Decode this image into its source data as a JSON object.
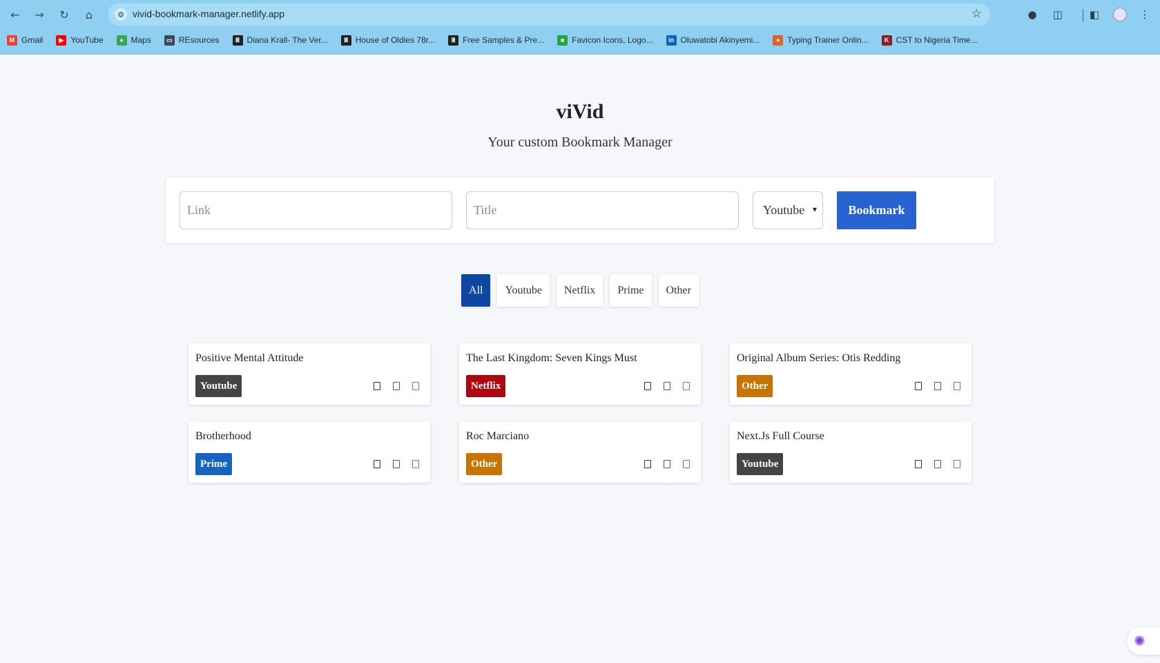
{
  "browser": {
    "url": "vivid-bookmark-manager.netlify.app",
    "icons": {
      "back": "arrow-left-icon",
      "forward": "arrow-right-icon",
      "reload": "reload-icon",
      "home": "home-icon",
      "site_info": "tune-icon",
      "star": "star-icon"
    },
    "bookmarks": [
      {
        "label": "Gmail",
        "icon": "gmail-icon",
        "color": "#ea4335",
        "glyph": "M"
      },
      {
        "label": "YouTube",
        "icon": "youtube-icon",
        "color": "#ff0000",
        "glyph": "▶"
      },
      {
        "label": "Maps",
        "icon": "maps-icon",
        "color": "#34a853",
        "glyph": "●"
      },
      {
        "label": "REsources",
        "icon": "folder-icon",
        "color": "#3c4a56",
        "glyph": "▭"
      },
      {
        "label": "Diana Krall- The Ver...",
        "icon": "site-icon",
        "color": "#222222",
        "glyph": "Ⅲ"
      },
      {
        "label": "House of Oldies 78r...",
        "icon": "site-icon",
        "color": "#222222",
        "glyph": "Ⅲ"
      },
      {
        "label": "Free Samples & Pre...",
        "icon": "piano-icon",
        "color": "#222222",
        "glyph": "Ⅲ"
      },
      {
        "label": "Favicon Icons, Logo...",
        "icon": "favicon-site-icon",
        "color": "#1fa83c",
        "glyph": "■"
      },
      {
        "label": "Oluwatobi Akinyemi...",
        "icon": "linkedin-icon",
        "color": "#0a66c2",
        "glyph": "in"
      },
      {
        "label": "Typing Trainer Onlin...",
        "icon": "typing-icon",
        "color": "#e0612e",
        "glyph": "●"
      },
      {
        "label": "CST to Nigeria Time...",
        "icon": "clock-site-icon",
        "color": "#8a1f1f",
        "glyph": "K"
      }
    ]
  },
  "header": {
    "title": "viVid",
    "subtitle": "Your custom Bookmark Manager"
  },
  "form": {
    "link_placeholder": "Link",
    "title_placeholder": "Title",
    "category_selected": "Youtube",
    "submit_label": "Bookmark",
    "accent": "#2762d1"
  },
  "filters": [
    {
      "label": "All",
      "active": true
    },
    {
      "label": "Youtube",
      "active": false
    },
    {
      "label": "Netflix",
      "active": false
    },
    {
      "label": "Prime",
      "active": false
    },
    {
      "label": "Other",
      "active": false
    }
  ],
  "bookmarks": [
    {
      "title": "Positive Mental Attitude",
      "category": "Youtube",
      "badge_color": "#444444"
    },
    {
      "title": "The Last Kingdom: Seven Kings Must",
      "category": "Netflix",
      "badge_color": "#b00610"
    },
    {
      "title": "Original Album Series: Otis Redding",
      "category": "Other",
      "badge_color": "#c97300"
    },
    {
      "title": "Brotherhood",
      "category": "Prime",
      "badge_color": "#1565c0"
    },
    {
      "title": "Roc Marciano",
      "category": "Other",
      "badge_color": "#c97300"
    },
    {
      "title": "Next.Js Full Course",
      "category": "Youtube",
      "badge_color": "#444444"
    }
  ],
  "card_actions": [
    {
      "name": "open-icon",
      "color": "#333333"
    },
    {
      "name": "edit-icon",
      "color": "#2762d1"
    },
    {
      "name": "delete-icon",
      "color": "#e05561"
    }
  ]
}
